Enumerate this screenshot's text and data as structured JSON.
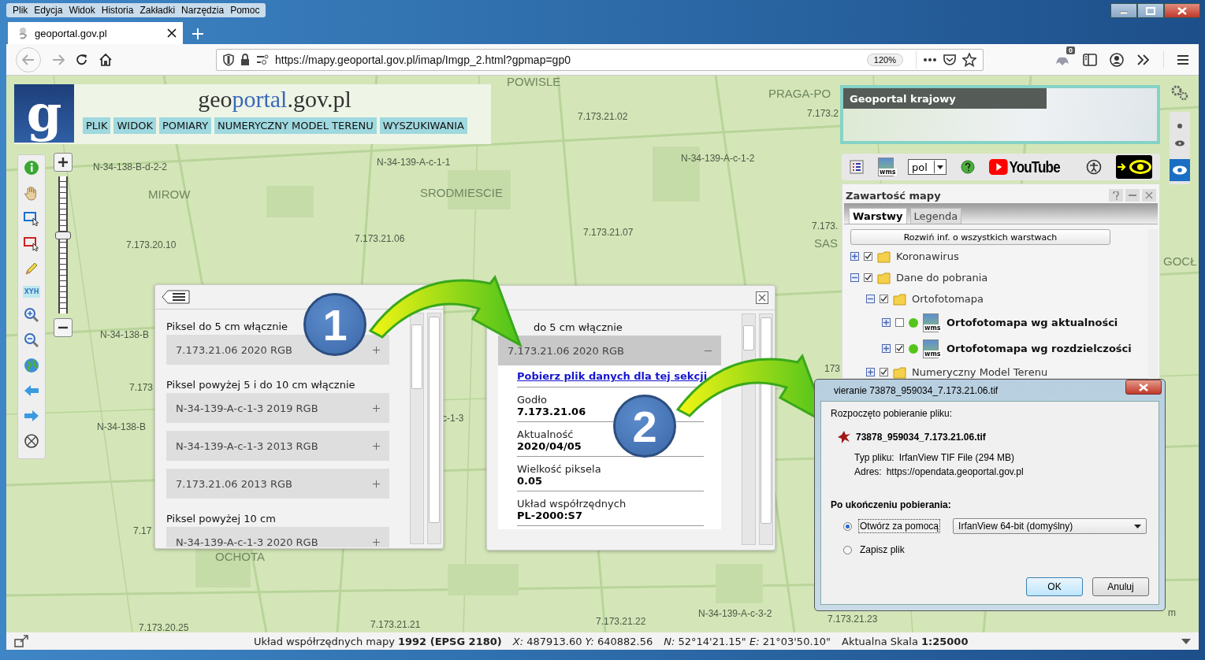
{
  "browser": {
    "menu": [
      "Plik",
      "Edycja",
      "Widok",
      "Historia",
      "Zakładki",
      "Narzędzia",
      "Pomoc"
    ],
    "tabs": [
      {
        "title": "geoportal.gov.pl",
        "selected": true
      }
    ],
    "url": "https://mapy.geoportal.gov.pl/imap/Imgp_2.html?gpmap=gp0",
    "zoom": "120%",
    "extension_badge": "0"
  },
  "header": {
    "logo": "g",
    "title": [
      "geo",
      "portal",
      ".gov.pl"
    ],
    "menu": [
      "PLIK",
      "WIDOK",
      "POMIARY",
      "NUMERYCZNY MODEL TERENU",
      "WYSZUKIWANIA"
    ]
  },
  "left_toolbar": {
    "coordinates_tool": "XYH"
  },
  "zoom_slider": {
    "level": 0.57
  },
  "map_labels": [
    {
      "text": "N-34-138-B-d-2-2",
      "kind": "sheet"
    },
    {
      "text": "MIROW",
      "kind": "district"
    },
    {
      "text": "N-34-139-A-c-1-1",
      "kind": "sheet"
    },
    {
      "text": "SRODMIESCIE",
      "kind": "district"
    },
    {
      "text": "7.173.21.02",
      "kind": "sheet"
    },
    {
      "text": "N-34-139-A-c-1-2",
      "kind": "sheet"
    },
    {
      "text": "7.173.21.06",
      "kind": "sheet"
    },
    {
      "text": "7.173.21.07",
      "kind": "sheet"
    },
    {
      "text": "7.173.20.10",
      "kind": "sheet"
    },
    {
      "text": "N-34-138-B",
      "kind": "sheet"
    },
    {
      "text": "7.173",
      "kind": "sheet"
    },
    {
      "text": "N-34-138-B",
      "kind": "sheet"
    },
    {
      "text": "7.17",
      "kind": "sheet"
    },
    {
      "text": "c-1-3",
      "kind": "sheet"
    },
    {
      "text": "OCHOTA",
      "kind": "district"
    },
    {
      "text": "7.173.20.25",
      "kind": "sheet"
    },
    {
      "text": "7.173.21.21",
      "kind": "sheet"
    },
    {
      "text": "7.173.21.22",
      "kind": "sheet"
    },
    {
      "text": "N-34-139-A-c-3-2",
      "kind": "sheet"
    },
    {
      "text": "7.173.21.23",
      "kind": "sheet"
    },
    {
      "text": "POWISLE",
      "kind": "district"
    },
    {
      "text": "PRAGA-PO",
      "kind": "district"
    },
    {
      "text": "7.173.2",
      "kind": "sheet"
    },
    {
      "text": "7.173.",
      "kind": "sheet"
    },
    {
      "text": "SAS",
      "kind": "district"
    },
    {
      "text": "173",
      "kind": "sheet"
    },
    {
      "text": "GOCŁ",
      "kind": "district"
    },
    {
      "text": "m",
      "kind": "sheet"
    }
  ],
  "minimap": {
    "title": "Geoportal krajowy"
  },
  "toolbar": {
    "wms_label": "wms",
    "language": "pol",
    "video_brand": "YouTube"
  },
  "map_contents": {
    "title": "Zawartość mapy",
    "tabs": [
      {
        "label": "Warstwy",
        "selected": true
      },
      {
        "label": "Legenda",
        "selected": false
      }
    ],
    "expand_all": "Rozwiń inf. o wszystkich warstwach",
    "tree": [
      {
        "label": "Koronawirus",
        "kind": "folder",
        "expanded": false,
        "checked": true
      },
      {
        "label": "Dane do pobrania",
        "kind": "folder",
        "expanded": true,
        "checked": true,
        "children": [
          {
            "label": "Ortofotomapa",
            "kind": "folder",
            "expanded": true,
            "checked": true,
            "children": [
              {
                "label": "Ortofotomapa wg aktualności",
                "kind": "layer",
                "tag": "wms",
                "expanded": false,
                "checked": false
              },
              {
                "label": "Ortofotomapa wg rozdzielczości",
                "kind": "layer",
                "tag": "wms",
                "expanded": false,
                "checked": true
              }
            ]
          },
          {
            "label": "Numeryczny Model Terenu",
            "kind": "folder",
            "expanded": false,
            "checked": true
          }
        ]
      }
    ]
  },
  "sections_panel": {
    "groups": [
      {
        "heading": "Piksel do 5 cm włącznie",
        "items": [
          {
            "label": "7.173.21.06 2020 RGB",
            "expanded": false
          }
        ]
      },
      {
        "heading": "Piksel powyżej 5 i do 10 cm włącznie",
        "items": [
          {
            "label": "N-34-139-A-c-1-3 2019 RGB",
            "expanded": false
          },
          {
            "label": "N-34-139-A-c-1-3 2013 RGB",
            "expanded": false
          },
          {
            "label": "7.173.21.06 2013 RGB",
            "expanded": false
          }
        ]
      },
      {
        "heading": "Piksel powyżej 10 cm",
        "items": [
          {
            "label": "N-34-139-A-c-1-3 2020 RGB",
            "expanded": false
          }
        ]
      }
    ]
  },
  "details_panel": {
    "heading": "do 5 cm włącznie",
    "item": {
      "label": "7.173.21.06 2020 RGB",
      "expanded": true
    },
    "link": "Pobierz plik danych dla tej sekcji",
    "fields": [
      {
        "label": "Godło",
        "value": "7.173.21.06"
      },
      {
        "label": "Aktualność",
        "value": "2020/04/05"
      },
      {
        "label": "Wielkość piksela",
        "value": "0.05"
      },
      {
        "label": "Układ współrzędnych",
        "value": "PL-2000:S7"
      }
    ]
  },
  "callouts": [
    "1",
    "2"
  ],
  "dialog": {
    "title": "vieranie 73878_959034_7.173.21.06.tif",
    "intro": "Rozpoczęto pobieranie pliku:",
    "file_name": "73878_959034_7.173.21.06.tif",
    "file_type_label": "Typ pliku:",
    "file_type": "IrfanView TIF File (294 MB)",
    "address_label": "Adres:",
    "address": "https://opendata.geoportal.gov.pl",
    "after_heading": "Po ukończeniu pobierania:",
    "options": [
      {
        "label": "Otwórz za pomocą",
        "selected": true
      },
      {
        "label": "Zapisz plik",
        "selected": false
      }
    ],
    "application": "IrfanView 64-bit (domyślny)",
    "buttons": [
      "OK",
      "Anuluj"
    ]
  },
  "status_bar": [
    "Układ współrzędnych mapy **1992 (EPSG 2180)**",
    "*X:* 487913.60 *Y:* 640882.56",
    "*N:* 52°14'21.15\" *E:* 21°03'50.10\"",
    "Aktualna Skala **1:25000**"
  ]
}
